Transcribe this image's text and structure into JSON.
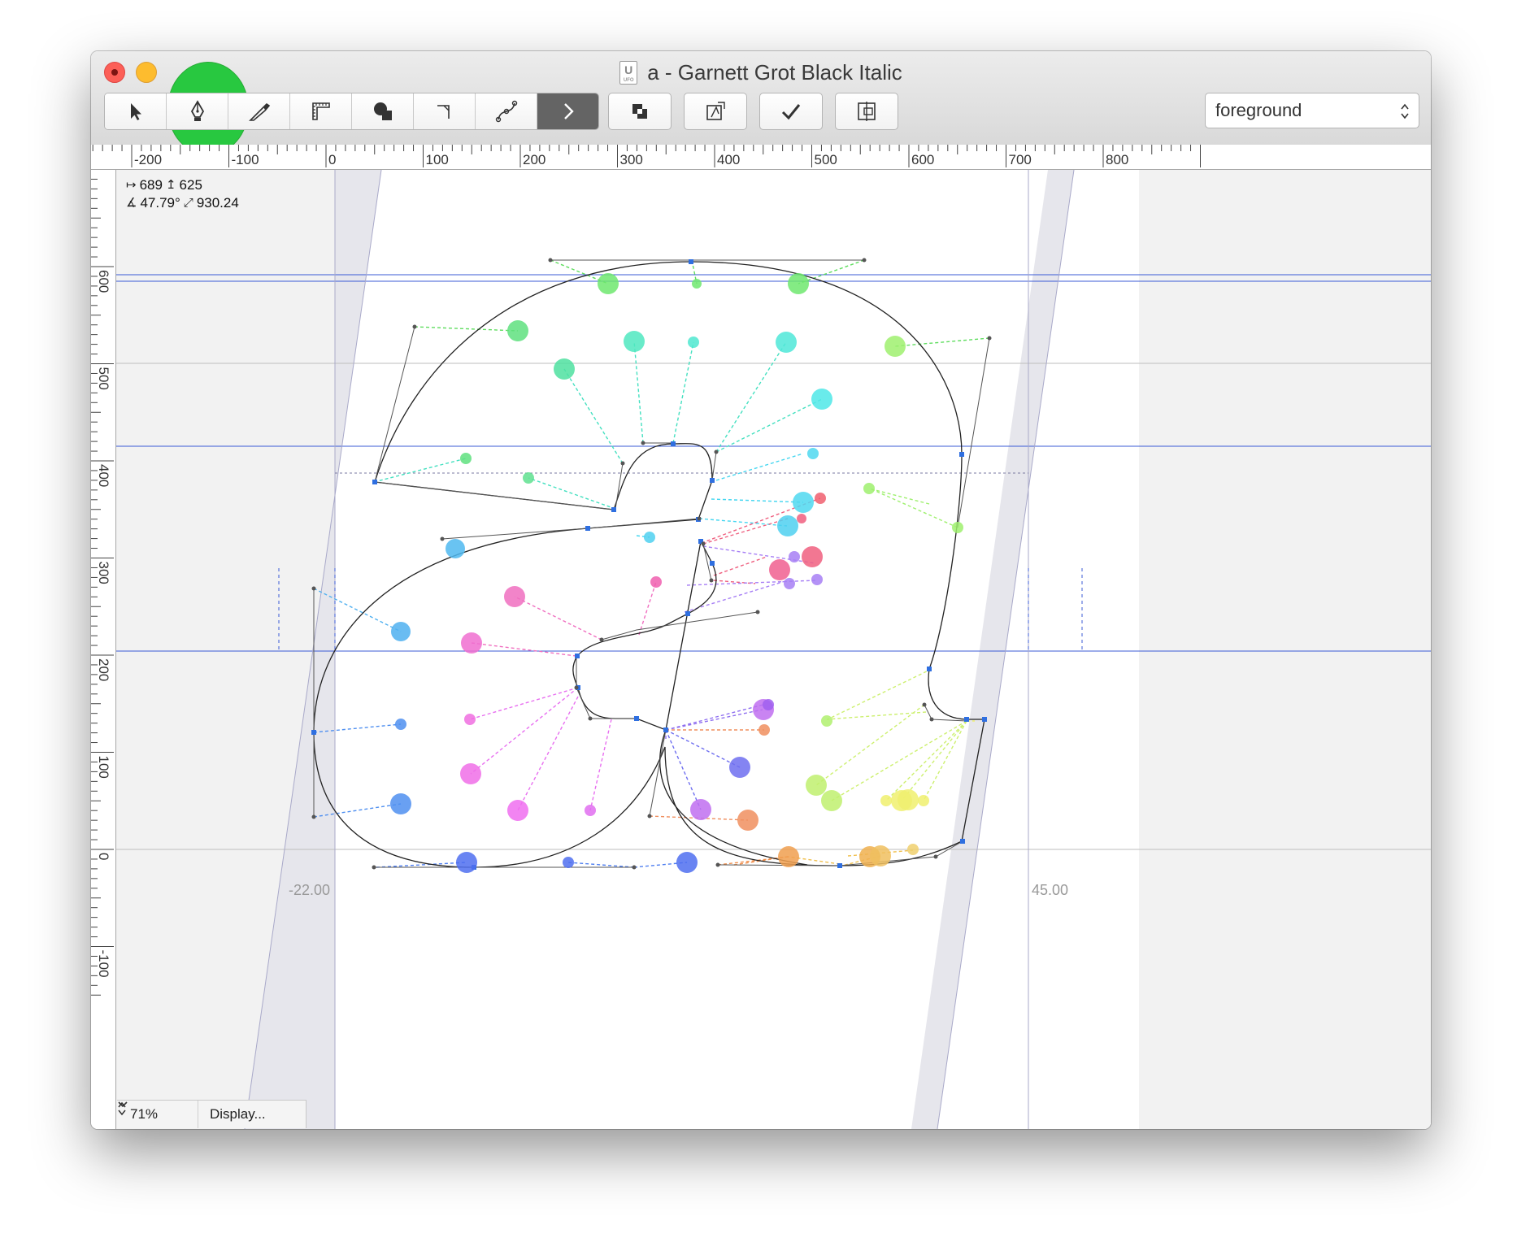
{
  "window": {
    "title": "a - Garnett Grot Black Italic",
    "doc_icon_letter": "U",
    "doc_icon_caption": "UFO"
  },
  "toolbar": {
    "tools": [
      "select-tool",
      "pen-tool",
      "knife-tool",
      "measure-tool",
      "shapes-tool",
      "corner-tool",
      "bender-tool",
      "more-tools"
    ],
    "actions": [
      "overlap-button",
      "preview-button",
      "validate-button",
      "compare-button"
    ],
    "layer_select": {
      "value": "foreground"
    }
  },
  "rulers": {
    "horizontal_labels": [
      "-200",
      "-100",
      "0",
      "100",
      "200",
      "300",
      "400",
      "500",
      "600",
      "700",
      "800"
    ],
    "vertical_labels": [
      "600",
      "500",
      "400",
      "300",
      "200",
      "100",
      "0",
      "-100"
    ]
  },
  "measure": {
    "x": "689",
    "y": "625",
    "angle": "47.79°",
    "distance": "930.24"
  },
  "margins": {
    "left": "-22.00",
    "right": "45.00"
  },
  "statusbar": {
    "zoom": "71%",
    "display": "Display..."
  }
}
